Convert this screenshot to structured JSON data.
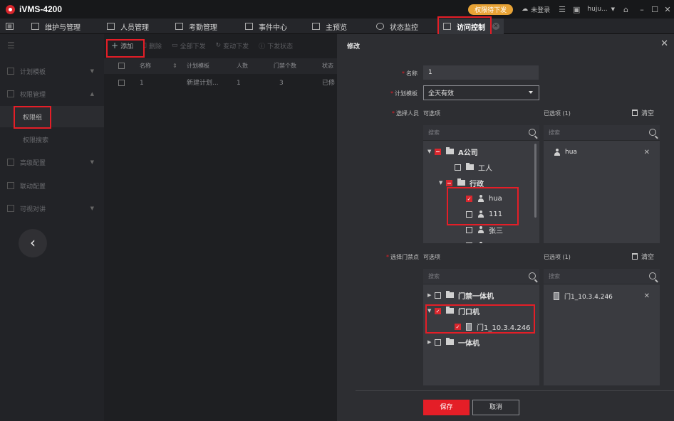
{
  "app": {
    "title": "iVMS-4200"
  },
  "titlebar": {
    "badge": "权限待下发",
    "login_status": "未登录",
    "user": "huju..."
  },
  "tabs": [
    {
      "label": "维护与管理"
    },
    {
      "label": "人员管理"
    },
    {
      "label": "考勤管理"
    },
    {
      "label": "事件中心"
    },
    {
      "label": "主预览"
    },
    {
      "label": "状态监控"
    },
    {
      "label": "访问控制",
      "active": true
    }
  ],
  "sidebar": {
    "items": [
      {
        "label": "计划模板"
      },
      {
        "label": "权限管理"
      },
      {
        "label": "权限组",
        "active": true
      },
      {
        "label": "权限搜索"
      },
      {
        "label": "高级配置"
      },
      {
        "label": "联动配置"
      },
      {
        "label": "可视对讲"
      }
    ]
  },
  "toolbar": {
    "add": "添加",
    "delete": "删除",
    "apply_all": "全部下发",
    "apply_changes": "变动下发",
    "apply_status": "下发状态"
  },
  "table": {
    "columns": [
      "名称",
      "计划模板",
      "人数",
      "门禁个数",
      "状态"
    ],
    "rows": [
      {
        "index": "1",
        "template": "新建计划...",
        "people": "1",
        "doors": "3",
        "status": "已修"
      }
    ]
  },
  "dialog": {
    "title": "修改",
    "name_label": "名称",
    "name_value": "1",
    "template_label": "计划模板",
    "template_value": "全天有效",
    "person_label": "选择人员",
    "door_label": "选择门禁点",
    "available": "可选项",
    "selected_people": "已选项 (1)",
    "selected_doors": "已选项 (1)",
    "clear": "清空",
    "search_placeholder": "搜索",
    "person_tree": {
      "company": "A公司",
      "worker": "工人",
      "admin_dept": "行政",
      "p1": "hua",
      "p2": "111",
      "p3": "张三"
    },
    "selected_person": "hua",
    "door_tree": {
      "group1": "门禁一体机",
      "group2": "门口机",
      "door": "门1_10.3.4.246",
      "group3": "一体机"
    },
    "selected_door": "门1_10.3.4.246",
    "save": "保存",
    "cancel": "取消"
  },
  "colors": {
    "accent": "#e41e27",
    "badge": "#e8a336"
  }
}
